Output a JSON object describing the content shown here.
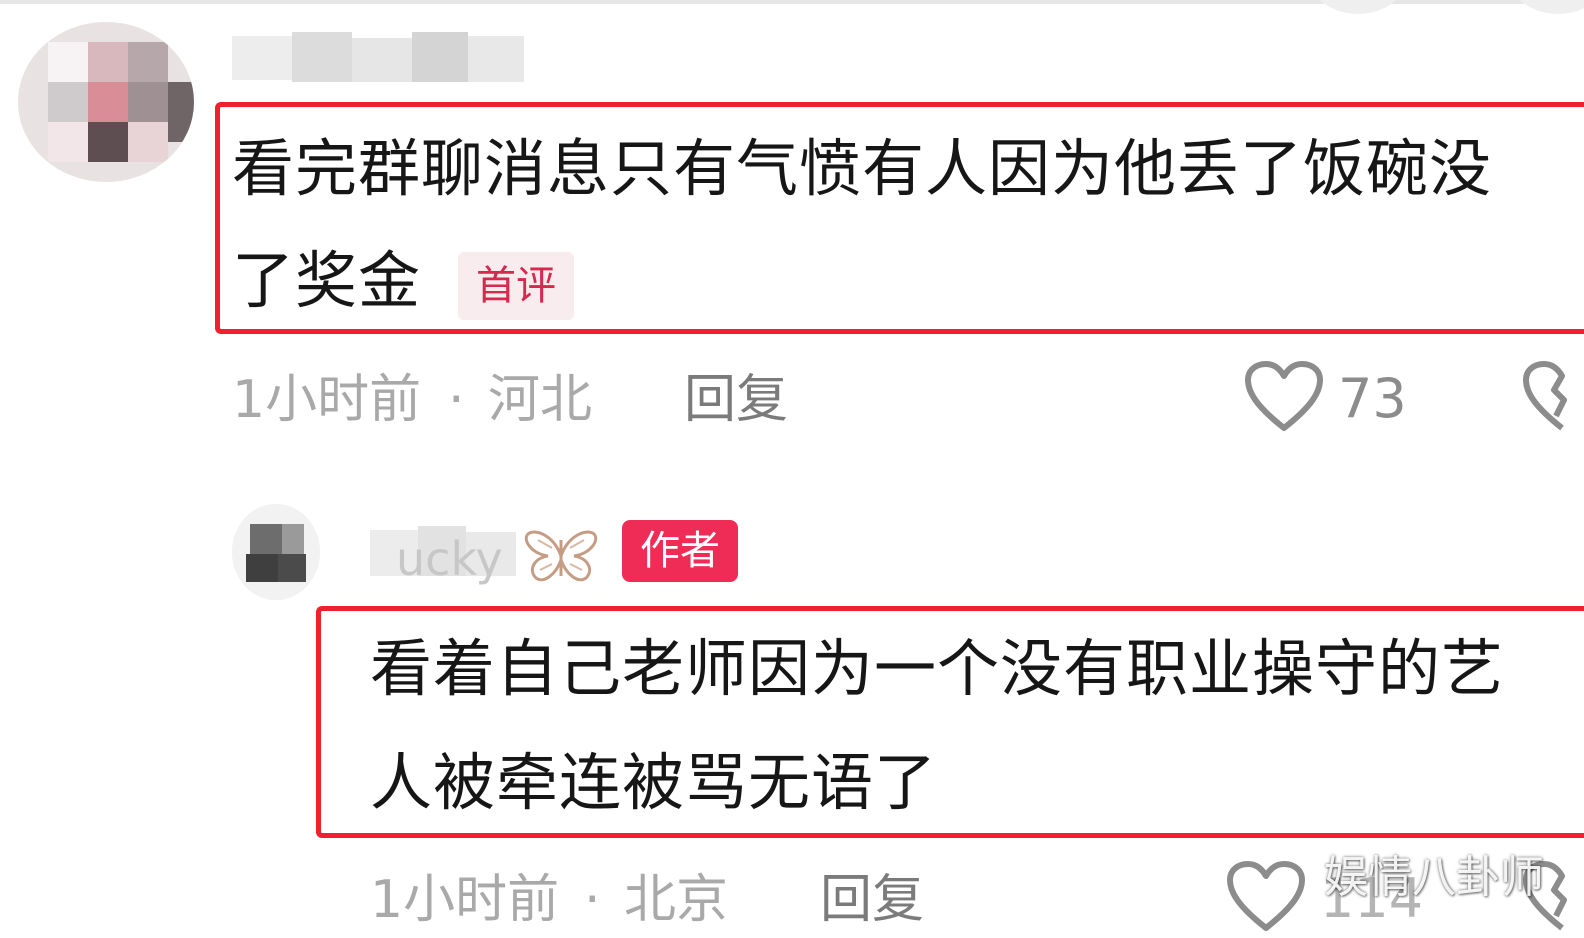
{
  "comments": [
    {
      "text_line1": "看完群聊消息只有气愤有人因为他丢了饭碗没",
      "text_line2": "了奖金",
      "badge": "首评",
      "time": "1小时前",
      "location": "河北",
      "meta_separator": "·",
      "reply_label": "回复",
      "likes": "73"
    },
    {
      "author_badge": "作者",
      "username_partial": "ucky",
      "text_line1": "看着自己老师因为一个没有职业操守的艺",
      "text_line2": "人被牵连被骂无语了",
      "time": "1小时前",
      "location": "北京",
      "meta_separator": "·",
      "reply_label": "回复",
      "likes": "114"
    }
  ],
  "watermark": "娱情八卦师",
  "colors": {
    "highlight_border": "#f0202c",
    "author_badge_bg": "#ee2c56",
    "first_badge_text": "#d5294d",
    "meta_text": "#a9a9a9"
  },
  "icons": {
    "like": "heart-outline-icon",
    "dislike": "broken-heart-icon",
    "username_decoration": "butterfly-icon"
  }
}
